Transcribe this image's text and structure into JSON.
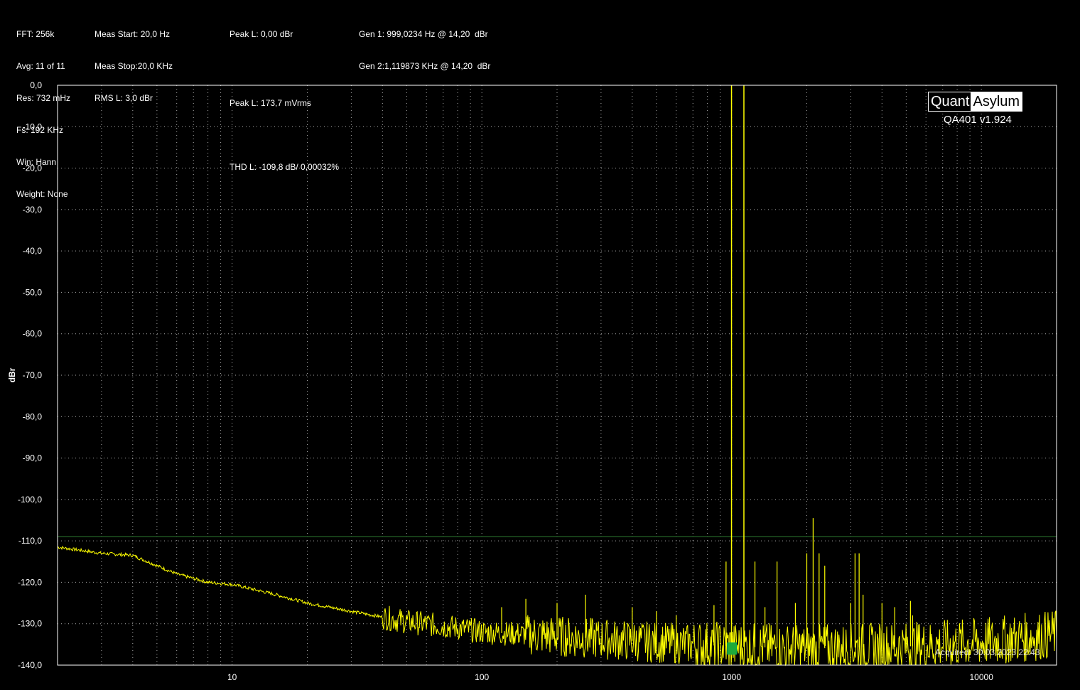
{
  "header": {
    "col1": [
      "FFT: 256k",
      "Avg: 11 of 11",
      "Res: 732 mHz",
      "Fs: 192 KHz",
      "Win: Hann",
      "Weight: None"
    ],
    "col2": [
      "Meas Start: 20,0 Hz",
      "Meas Stop:20,0 KHz",
      "RMS L: 3,0 dBr"
    ],
    "col3": [
      "Peak L: 0,00 dBr",
      "",
      "Peak L: 173,7 mVrms",
      "",
      "THD L: -109,8 dB/ 0,00032%"
    ],
    "col4": [
      "Gen 1: 999,0234 Hz @ 14,20  dBr",
      "Gen 2:1,119873 KHz @ 14,20  dBr"
    ]
  },
  "logo": {
    "left": "Quant",
    "right": "Asylum",
    "version": "QA401 v1.924"
  },
  "acquired": "Acquired: 30.03.2023  22:43",
  "colors": {
    "trace": "#ffff00",
    "background": "#000000",
    "grid": "#aaaaaa",
    "threshold": "#2e7d32",
    "marker": "#1faa3a"
  },
  "chart_data": {
    "type": "line",
    "title": "",
    "xlabel": "",
    "ylabel": "dBr",
    "x_scale": "log",
    "xlim": [
      2,
      20000
    ],
    "ylim": [
      -140,
      0
    ],
    "x_ticks": [
      10,
      100,
      1000,
      10000
    ],
    "x_tick_labels": [
      "10",
      "100",
      "1000",
      "10000"
    ],
    "y_ticks": [
      0,
      -10,
      -20,
      -30,
      -40,
      -50,
      -60,
      -70,
      -80,
      -90,
      -100,
      -110,
      -120,
      -130,
      -140
    ],
    "y_tick_labels": [
      "0,0",
      "-10,0",
      "-20,0",
      "-30,0",
      "-40,0",
      "-50,0",
      "-60,0",
      "-70,0",
      "-80,0",
      "-90,0",
      "-100,0",
      "-110,0",
      "-120,0",
      "-130,0",
      "-140,0"
    ],
    "grid": true,
    "threshold_level": -109,
    "marker": {
      "x": 1000,
      "y": -136
    },
    "noise_floor": {
      "x": [
        2,
        3,
        4,
        6,
        8,
        10,
        15,
        20,
        30,
        50,
        80,
        100,
        200,
        500,
        1000,
        2000,
        5000,
        10000,
        20000
      ],
      "y": [
        -111.5,
        -113,
        -113.5,
        -118,
        -120,
        -120.5,
        -123,
        -125,
        -127,
        -129.5,
        -131,
        -132,
        -133,
        -134.5,
        -135.5,
        -136,
        -135.5,
        -134.5,
        -132.5
      ]
    },
    "spurs": {
      "x": [
        999.0234,
        1119.873,
        120,
        150,
        200,
        260,
        400,
        500,
        600,
        850,
        950,
        1240,
        1360,
        1520,
        1800,
        2000,
        2120,
        2240,
        2360,
        3000,
        3120,
        3240,
        3360,
        4000,
        4500,
        5200,
        5300
      ],
      "y": [
        0,
        0,
        -126,
        -124,
        -125,
        -123,
        -126,
        -127,
        -128,
        -125.5,
        -115,
        -115,
        -126,
        -115,
        -125,
        -113,
        -104.5,
        -113,
        -116,
        -125,
        -113,
        -113,
        -123,
        -125,
        -126,
        -124.5,
        -128
      ]
    }
  }
}
